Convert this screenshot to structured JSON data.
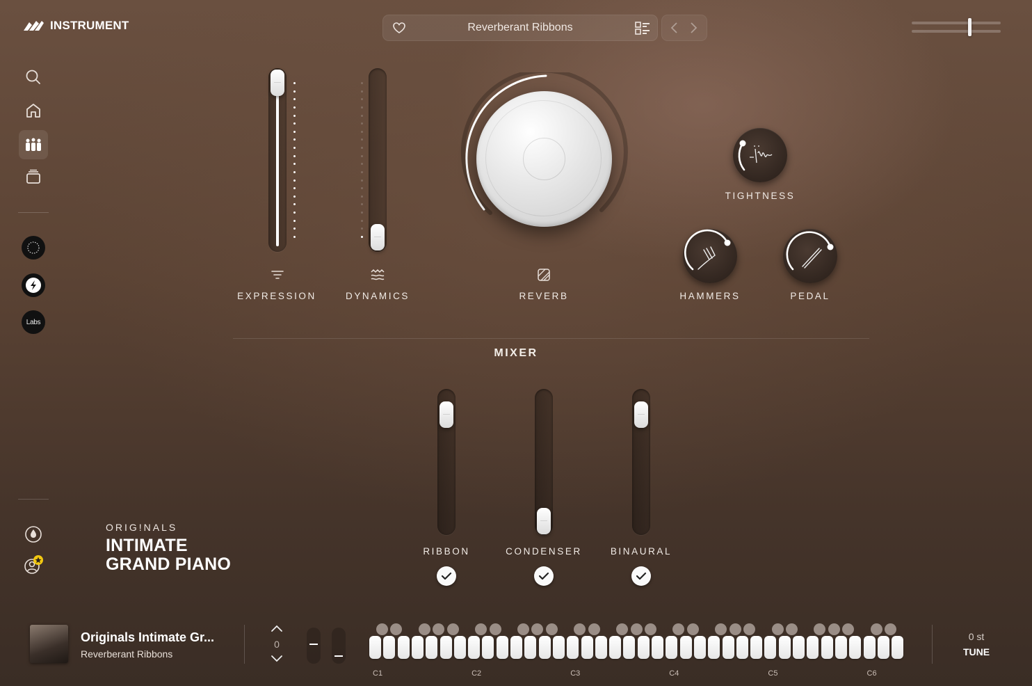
{
  "app": {
    "logo_text": "INSTRUMENT"
  },
  "preset": {
    "name": "Reverberant Ribbons"
  },
  "sidebar": {
    "icons": [
      "search-icon",
      "home-icon",
      "instruments-icon",
      "library-icon"
    ],
    "brands": [
      "originals-badge",
      "spitfire-badge",
      "labs-badge"
    ],
    "labs_text": "Labs",
    "bottom_icons": [
      "drop-icon",
      "account-icon"
    ]
  },
  "controls": {
    "expression": {
      "label": "EXPRESSION",
      "value": 1.0
    },
    "dynamics": {
      "label": "DYNAMICS",
      "value": 0.0
    },
    "reverb": {
      "label": "REVERB",
      "value": 0.55
    },
    "tightness": {
      "label": "TIGHTNESS"
    },
    "hammers": {
      "label": "HAMMERS"
    },
    "pedal": {
      "label": "PEDAL"
    }
  },
  "mixer": {
    "title": "MIXER",
    "channels": [
      {
        "label": "RIBBON",
        "value": 1.0,
        "enabled": true
      },
      {
        "label": "CONDENSER",
        "value": 0.0,
        "enabled": true
      },
      {
        "label": "BINAURAL",
        "value": 1.0,
        "enabled": true
      }
    ]
  },
  "product": {
    "series": "ORIG!NALS",
    "title_line1": "INTIMATE",
    "title_line2": "GRAND PIANO"
  },
  "bottom": {
    "title": "Originals Intimate Gr...",
    "subtitle": "Reverberant Ribbons",
    "octave": "0",
    "octave_labels": [
      "C1",
      "C2",
      "C3",
      "C4",
      "C5",
      "C6"
    ],
    "tune_value": "0 st",
    "tune_label": "TUNE"
  },
  "colors": {
    "accent": "#ffffff",
    "background": "#5b4334",
    "badge_star": "#f2c811"
  }
}
